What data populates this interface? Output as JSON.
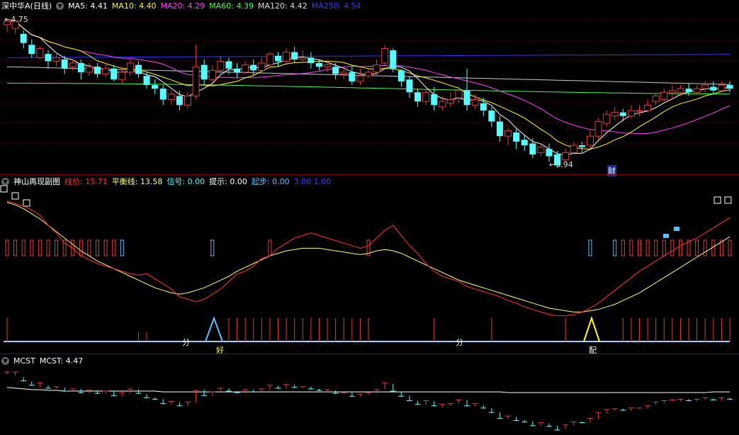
{
  "colors": {
    "bg": "#000000",
    "up": "#e33b3b",
    "down": "#54ffff",
    "grid": "#6e0000",
    "ma5": "#ffffff",
    "ma10": "#ffff00",
    "ma20": "#ff40ff",
    "ma60": "#40ff40",
    "ma120": "#c8c8c8",
    "ma250": "#3333ff",
    "price_line": "#ff3030",
    "balance_line": "#ffff66",
    "signal_blue": "#54c0ff",
    "mcst_line": "#ffffff"
  },
  "top": {
    "title": "深中华A(日线)",
    "ma5_label": "MA5:",
    "ma5": "4.41",
    "ma10_label": "MA10:",
    "ma10": "4.40",
    "ma20_label": "MA20:",
    "ma20": "4.29",
    "ma60_label": "MA60:",
    "ma60": "4.39",
    "ma120_label": "MA120:",
    "ma120": "4.42",
    "ma250_label": "MA250:",
    "ma250": "4.54",
    "high_mark": "4.75",
    "low_mark": "3.94",
    "finance_mark": "财"
  },
  "mid": {
    "title": "神山再现副图",
    "price_label": "线价:",
    "price": "15.71",
    "balance_label": "平衡线:",
    "balance": "13.58",
    "signal_label": "信号:",
    "signal": "0.00",
    "hint_label": "提示:",
    "hint": "0.00",
    "start_label": "起步:",
    "start": "0.00",
    "extra": "3.00 1.00",
    "mark_fen": "分",
    "mark_hao": "好",
    "mark_pei": "配"
  },
  "bottom": {
    "title": "MCST",
    "mcst_label": "MCST:",
    "mcst": "4.47"
  },
  "chart_data": {
    "type": "candlestick",
    "candles": [
      [
        4.71,
        4.73,
        4.67,
        4.75
      ],
      [
        4.69,
        4.73,
        4.66,
        4.74
      ],
      [
        4.66,
        4.61,
        4.58,
        4.68
      ],
      [
        4.6,
        4.55,
        4.53,
        4.63
      ],
      [
        4.53,
        4.58,
        4.52,
        4.59
      ],
      [
        4.55,
        4.51,
        4.47,
        4.57
      ],
      [
        4.51,
        4.53,
        4.48,
        4.56
      ],
      [
        4.52,
        4.47,
        4.44,
        4.54
      ],
      [
        4.48,
        4.5,
        4.46,
        4.52
      ],
      [
        4.5,
        4.45,
        4.41,
        4.52
      ],
      [
        4.45,
        4.48,
        4.43,
        4.5
      ],
      [
        4.48,
        4.44,
        4.42,
        4.5
      ],
      [
        4.44,
        4.47,
        4.42,
        4.5
      ],
      [
        4.47,
        4.41,
        4.4,
        4.49
      ],
      [
        4.41,
        4.45,
        4.39,
        4.48
      ],
      [
        4.45,
        4.5,
        4.43,
        4.52
      ],
      [
        4.49,
        4.44,
        4.42,
        4.51
      ],
      [
        4.43,
        4.38,
        4.36,
        4.45
      ],
      [
        4.38,
        4.36,
        4.33,
        4.41
      ],
      [
        4.36,
        4.3,
        4.27,
        4.38
      ],
      [
        4.3,
        4.33,
        4.27,
        4.35
      ],
      [
        4.32,
        4.27,
        4.24,
        4.35
      ],
      [
        4.27,
        4.32,
        4.25,
        4.34
      ],
      [
        4.32,
        4.48,
        4.3,
        4.6
      ],
      [
        4.49,
        4.41,
        4.38,
        4.52
      ],
      [
        4.41,
        4.46,
        4.4,
        4.49
      ],
      [
        4.46,
        4.51,
        4.44,
        4.54
      ],
      [
        4.51,
        4.47,
        4.44,
        4.53
      ],
      [
        4.47,
        4.45,
        4.42,
        4.5
      ],
      [
        4.45,
        4.49,
        4.44,
        4.51
      ],
      [
        4.49,
        4.46,
        4.43,
        4.52
      ],
      [
        4.46,
        4.5,
        4.44,
        4.53
      ],
      [
        4.49,
        4.55,
        4.47,
        4.56
      ],
      [
        4.54,
        4.51,
        4.48,
        4.56
      ],
      [
        4.51,
        4.56,
        4.49,
        4.58
      ],
      [
        4.56,
        4.52,
        4.5,
        4.59
      ],
      [
        4.52,
        4.53,
        4.5,
        4.57
      ],
      [
        4.53,
        4.5,
        4.47,
        4.56
      ],
      [
        4.5,
        4.48,
        4.46,
        4.52
      ],
      [
        4.48,
        4.49,
        4.45,
        4.52
      ],
      [
        4.48,
        4.44,
        4.41,
        4.5
      ],
      [
        4.44,
        4.45,
        4.41,
        4.48
      ],
      [
        4.45,
        4.4,
        4.38,
        4.48
      ],
      [
        4.4,
        4.43,
        4.38,
        4.47
      ],
      [
        4.43,
        4.45,
        4.42,
        4.47
      ],
      [
        4.45,
        4.49,
        4.43,
        4.52
      ],
      [
        4.5,
        4.58,
        4.48,
        4.6
      ],
      [
        4.57,
        4.47,
        4.45,
        4.58
      ],
      [
        4.46,
        4.4,
        4.37,
        4.47
      ],
      [
        4.41,
        4.34,
        4.31,
        4.43
      ],
      [
        4.34,
        4.29,
        4.26,
        4.36
      ],
      [
        4.29,
        4.34,
        4.27,
        4.36
      ],
      [
        4.33,
        4.27,
        4.24,
        4.37
      ],
      [
        4.26,
        4.29,
        4.24,
        4.32
      ],
      [
        4.28,
        4.3,
        4.26,
        4.34
      ],
      [
        4.31,
        4.35,
        4.28,
        4.37
      ],
      [
        4.35,
        4.27,
        4.24,
        4.47
      ],
      [
        4.27,
        4.3,
        4.25,
        4.33
      ],
      [
        4.28,
        4.24,
        4.21,
        4.31
      ],
      [
        4.24,
        4.18,
        4.15,
        4.26
      ],
      [
        4.18,
        4.1,
        4.07,
        4.21
      ],
      [
        4.1,
        4.13,
        4.05,
        4.15
      ],
      [
        4.12,
        4.07,
        4.03,
        4.14
      ],
      [
        4.08,
        4.05,
        4.02,
        4.11
      ],
      [
        4.06,
        4.0,
        3.98,
        4.09
      ],
      [
        4.01,
        4.04,
        3.99,
        4.06
      ],
      [
        4.03,
        3.99,
        3.96,
        4.06
      ],
      [
        4.0,
        3.94,
        3.93,
        4.02
      ],
      [
        3.97,
        4.01,
        3.96,
        4.03
      ],
      [
        4.01,
        4.05,
        4.0,
        4.07
      ],
      [
        4.05,
        4.04,
        4.01,
        4.07
      ],
      [
        4.05,
        4.1,
        4.03,
        4.13
      ],
      [
        4.1,
        4.18,
        4.08,
        4.2
      ],
      [
        4.17,
        4.22,
        4.15,
        4.24
      ],
      [
        4.21,
        4.23,
        4.19,
        4.26
      ],
      [
        4.23,
        4.21,
        4.18,
        4.25
      ],
      [
        4.21,
        4.24,
        4.2,
        4.27
      ],
      [
        4.24,
        4.24,
        4.21,
        4.27
      ],
      [
        4.24,
        4.27,
        4.23,
        4.3
      ],
      [
        4.29,
        4.32,
        4.27,
        4.33
      ],
      [
        4.3,
        4.34,
        4.29,
        4.36
      ],
      [
        4.34,
        4.35,
        4.31,
        4.38
      ],
      [
        4.34,
        4.36,
        4.32,
        4.38
      ],
      [
        4.36,
        4.34,
        4.32,
        4.39
      ],
      [
        4.34,
        4.36,
        4.33,
        4.38
      ],
      [
        4.36,
        4.38,
        4.34,
        4.4
      ],
      [
        4.37,
        4.35,
        4.33,
        4.4
      ],
      [
        4.35,
        4.38,
        4.34,
        4.4
      ],
      [
        4.38,
        4.36,
        4.34,
        4.4
      ]
    ],
    "ylim": [
      3.93,
      4.76
    ]
  },
  "indicator_data": {
    "price_line": [
      99,
      97,
      95,
      92,
      88,
      80,
      74,
      66,
      62,
      56,
      53,
      50,
      48,
      46,
      44,
      42,
      41,
      42,
      38,
      34,
      30,
      24,
      22,
      20,
      22,
      26,
      30,
      36,
      42,
      44,
      48,
      54,
      56,
      62,
      66,
      70,
      72,
      74,
      72,
      70,
      68,
      66,
      64,
      62,
      64,
      70,
      76,
      80,
      72,
      64,
      58,
      50,
      44,
      40,
      38,
      36,
      32,
      30,
      28,
      26,
      24,
      21,
      19,
      16,
      14,
      12,
      10,
      9,
      9,
      10,
      12,
      15,
      19,
      24,
      29,
      34,
      39,
      44,
      48,
      52,
      56,
      60,
      64,
      67,
      70,
      74,
      78,
      82,
      86
    ],
    "balance_line": [
      98,
      96,
      93,
      89,
      85,
      80,
      75,
      70,
      65,
      60,
      56,
      52,
      49,
      46,
      43,
      40,
      37,
      34,
      31,
      29,
      27,
      26,
      27,
      29,
      31,
      34,
      37,
      40,
      44,
      47,
      50,
      53,
      56,
      58,
      60,
      61,
      62,
      62,
      62,
      61,
      60,
      59,
      58,
      57,
      58,
      60,
      61,
      60,
      58,
      55,
      52,
      49,
      46,
      43,
      40,
      37,
      35,
      33,
      31,
      29,
      27,
      25,
      23,
      21,
      19,
      17,
      15,
      14,
      13,
      12,
      12,
      13,
      14,
      16,
      18,
      21,
      24,
      27,
      31,
      35,
      39,
      43,
      47,
      51,
      55,
      59,
      63,
      67,
      71
    ]
  },
  "mcst_data": [
    4.52,
    4.51,
    4.5,
    4.49,
    4.49,
    4.48,
    4.48,
    4.47,
    4.47,
    4.47,
    4.47,
    4.47,
    4.47,
    4.47,
    4.47,
    4.47,
    4.47,
    4.47,
    4.47,
    4.46,
    4.46,
    4.46,
    4.46,
    4.46,
    4.46,
    4.46,
    4.46,
    4.46,
    4.46,
    4.46,
    4.46,
    4.46,
    4.46,
    4.46,
    4.46,
    4.46,
    4.46,
    4.46,
    4.46,
    4.46,
    4.46,
    4.46,
    4.46,
    4.46,
    4.46,
    4.46,
    4.46,
    4.46,
    4.46,
    4.46,
    4.46,
    4.46,
    4.46,
    4.46,
    4.46,
    4.46,
    4.46,
    4.46,
    4.46,
    4.46,
    4.46,
    4.45,
    4.45,
    4.45,
    4.45,
    4.45,
    4.45,
    4.45,
    4.45,
    4.45,
    4.45,
    4.45,
    4.45,
    4.45,
    4.45,
    4.45,
    4.45,
    4.45,
    4.45,
    4.45,
    4.45,
    4.45,
    4.45,
    4.45,
    4.45,
    4.45,
    4.46,
    4.46,
    4.46
  ]
}
